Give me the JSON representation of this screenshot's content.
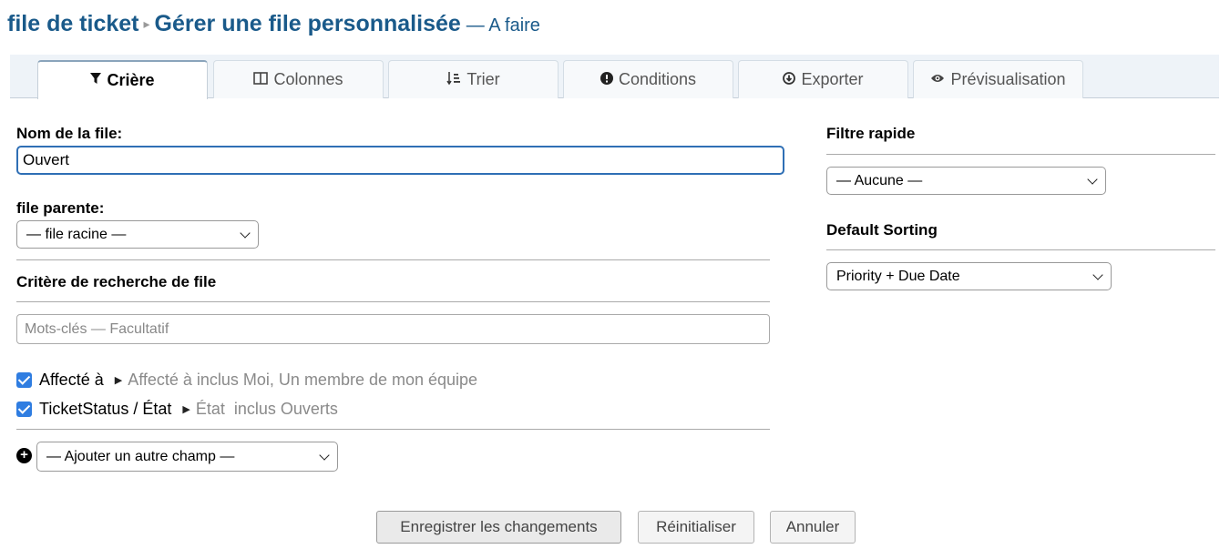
{
  "title": {
    "crumb": "file de ticket",
    "main": "Gérer une file personnalisée",
    "sub": "— A faire"
  },
  "tabs": [
    {
      "label": "Crière",
      "icon": "filter-icon"
    },
    {
      "label": "Colonnes",
      "icon": "columns-icon"
    },
    {
      "label": "Trier",
      "icon": "sort-icon"
    },
    {
      "label": "Conditions",
      "icon": "exclamation-icon"
    },
    {
      "label": "Exporter",
      "icon": "download-icon"
    },
    {
      "label": "Prévisualisation",
      "icon": "eye-icon"
    }
  ],
  "form": {
    "name_label": "Nom de la file:",
    "name_value": "Ouvert",
    "parent_label": "file parente:",
    "parent_value": "— file racine —",
    "criteria_heading": "Critère de recherche de file",
    "keywords_placeholder": "Mots-clés — Facultatif",
    "criteria": [
      {
        "field": "Affecté à",
        "summary": "Affecté à inclus Moi, Un membre de mon équipe"
      },
      {
        "field": "TicketStatus / État",
        "summary": "État  inclus Ouverts"
      }
    ],
    "add_field_value": "— Ajouter un autre champ —"
  },
  "sidebar": {
    "quick_filter_label": "Filtre rapide",
    "quick_filter_value": "— Aucune —",
    "default_sorting_label": "Default Sorting",
    "default_sorting_value": "Priority + Due Date"
  },
  "buttons": {
    "save": "Enregistrer les changements",
    "reset": "Réinitialiser",
    "cancel": "Annuler"
  },
  "colors": {
    "title": "#1a5a8a",
    "focus_border": "#2f6fb5",
    "checkbox": "#2f7de1"
  }
}
